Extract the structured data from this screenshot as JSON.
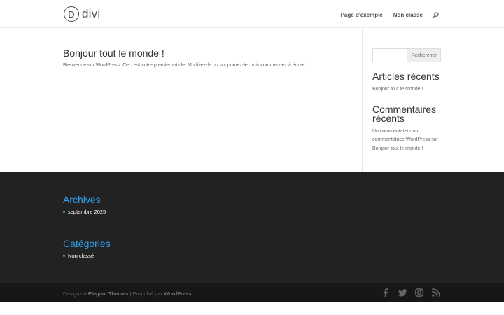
{
  "header": {
    "logo_letter": "D",
    "logo_text": "divi",
    "nav": [
      {
        "label": "Page d'exemple"
      },
      {
        "label": "Non classé"
      }
    ],
    "search_icon": "search-icon"
  },
  "post": {
    "title": "Bonjour tout le monde !",
    "excerpt": "Bienvenue sur WordPress. Ceci est votre premier article. Modifiez-le ou supprimez-le, puis commencez à écrire !"
  },
  "sidebar": {
    "search": {
      "placeholder": "",
      "button_label": "Rechercher"
    },
    "recent_posts": {
      "title": "Articles récents",
      "items": [
        "Bonjour tout le monde !"
      ]
    },
    "recent_comments": {
      "title": "Commentaires récents",
      "author": "Un commentateur ou commentatrice WordPress",
      "connector": " sur ",
      "post": "Bonjour tout le monde !"
    }
  },
  "footer": {
    "archives": {
      "title": "Archives",
      "items": [
        "septembre 2025"
      ]
    },
    "categories": {
      "title": "Catégories",
      "items": [
        "Non classé"
      ]
    }
  },
  "bottom": {
    "design_prefix": "Design de ",
    "design_link": "Elegant Themes",
    "separator": " | Propulsé par ",
    "powered_link": "WordPress",
    "social": [
      "facebook-icon",
      "twitter-icon",
      "instagram-icon",
      "rss-icon"
    ]
  },
  "colors": {
    "accent": "#2ea3f2",
    "footer_bg": "#222222",
    "bottom_bg": "#171717"
  }
}
